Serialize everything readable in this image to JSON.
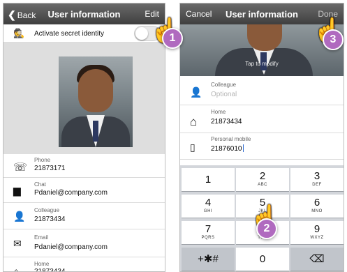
{
  "left_screen": {
    "back_label": "Back",
    "title": "User information",
    "edit_label": "Edit",
    "secret_identity_label": "Activate secret identity",
    "contacts": [
      {
        "icon": "phone-icon",
        "label": "Phone",
        "value": "21873171"
      },
      {
        "icon": "chat-icon",
        "label": "Chat",
        "value": "Pdaniel@company.com"
      },
      {
        "icon": "person-icon",
        "label": "Colleague",
        "value": "21873434"
      },
      {
        "icon": "mail-icon",
        "label": "Email",
        "value": "Pdaniel@company.com"
      },
      {
        "icon": "home-icon",
        "label": "Home",
        "value": "21873434"
      }
    ]
  },
  "right_screen": {
    "cancel_label": "Cancel",
    "title": "User information",
    "done_label": "Done",
    "tap_hint": "Tap to modify",
    "fields": [
      {
        "icon": "person-icon",
        "label": "Colleague",
        "placeholder": "Optional",
        "value": ""
      },
      {
        "icon": "home-icon",
        "label": "Home",
        "placeholder": "",
        "value": "21873434"
      },
      {
        "icon": "mobile-icon",
        "label": "Personal mobile",
        "placeholder": "",
        "value": "21876010"
      }
    ],
    "keypad": [
      {
        "num": "1",
        "letters": ""
      },
      {
        "num": "2",
        "letters": "ABC"
      },
      {
        "num": "3",
        "letters": "DEF"
      },
      {
        "num": "4",
        "letters": "GHI"
      },
      {
        "num": "5",
        "letters": "JKL"
      },
      {
        "num": "6",
        "letters": "MNO"
      },
      {
        "num": "7",
        "letters": "PQRS"
      },
      {
        "num": "8",
        "letters": "TUV"
      },
      {
        "num": "9",
        "letters": "WXYZ"
      },
      {
        "num": "+✱#",
        "letters": ""
      },
      {
        "num": "0",
        "letters": ""
      },
      {
        "num": "⌫",
        "letters": ""
      }
    ]
  },
  "callouts": [
    "1",
    "2",
    "3"
  ],
  "colors": {
    "callout": "#b06abf",
    "navbar": "#4a4a4a",
    "cursor": "#2e6ad1"
  }
}
